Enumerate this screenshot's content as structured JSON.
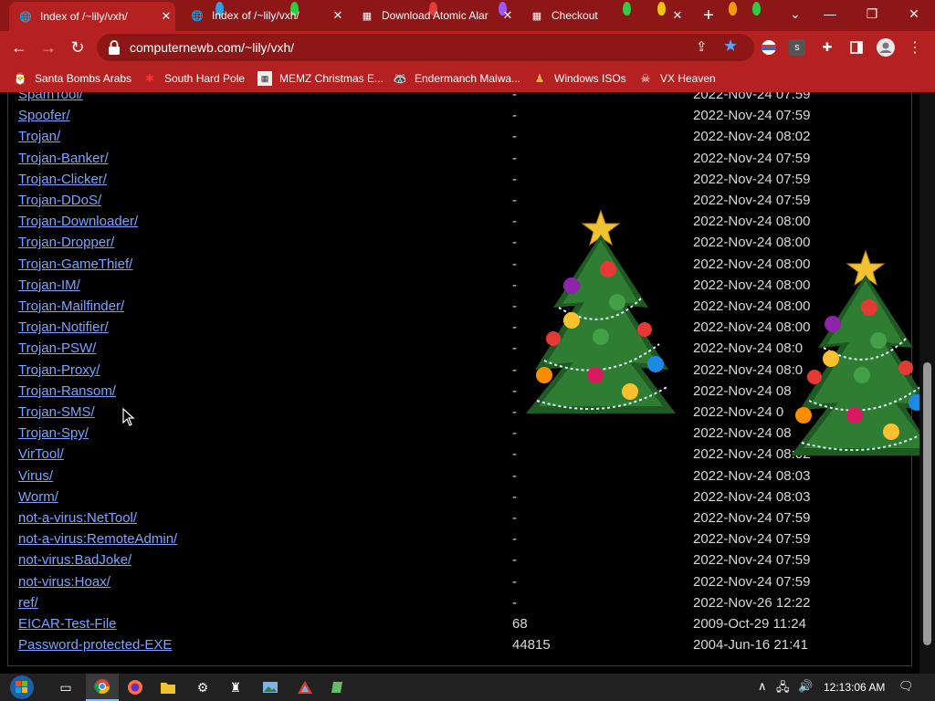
{
  "browser": {
    "tabs": [
      {
        "title": "Index of /~lily/vxh/",
        "active": true
      },
      {
        "title": "Index of /~lily/vxh/",
        "active": false
      },
      {
        "title": "Download Atomic Alar",
        "active": false
      },
      {
        "title": "Checkout",
        "active": false
      }
    ],
    "url": "computernewb.com/~lily/vxh/",
    "bookmarks": [
      {
        "label": "Santa Bombs Arabs",
        "icon": "santa-icon"
      },
      {
        "label": "South Hard Pole",
        "icon": "snowflake-icon"
      },
      {
        "label": "MEMZ Christmas E...",
        "icon": "memz-icon"
      },
      {
        "label": "Endermanch Malwa...",
        "icon": "raccoon-icon"
      },
      {
        "label": "Windows ISOs",
        "icon": "figure-icon"
      },
      {
        "label": "VX Heaven",
        "icon": "skull-icon"
      }
    ],
    "accent_color": "#b52121",
    "tabstrip_color": "#8d1616"
  },
  "listing": {
    "rows": [
      {
        "name": "SpamTool/",
        "size": "-",
        "date": "2022-Nov-24 07:59"
      },
      {
        "name": "Spoofer/",
        "size": "-",
        "date": "2022-Nov-24 07:59"
      },
      {
        "name": "Trojan/",
        "size": "-",
        "date": "2022-Nov-24 08:02"
      },
      {
        "name": "Trojan-Banker/",
        "size": "-",
        "date": "2022-Nov-24 07:59"
      },
      {
        "name": "Trojan-Clicker/",
        "size": "-",
        "date": "2022-Nov-24 07:59"
      },
      {
        "name": "Trojan-DDoS/",
        "size": "-",
        "date": "2022-Nov-24 07:59"
      },
      {
        "name": "Trojan-Downloader/",
        "size": "-",
        "date": "2022-Nov-24 08:00"
      },
      {
        "name": "Trojan-Dropper/",
        "size": "-",
        "date": "2022-Nov-24 08:00"
      },
      {
        "name": "Trojan-GameThief/",
        "size": "-",
        "date": "2022-Nov-24 08:00"
      },
      {
        "name": "Trojan-IM/",
        "size": "-",
        "date": "2022-Nov-24 08:00"
      },
      {
        "name": "Trojan-Mailfinder/",
        "size": "-",
        "date": "2022-Nov-24 08:00"
      },
      {
        "name": "Trojan-Notifier/",
        "size": "-",
        "date": "2022-Nov-24 08:00"
      },
      {
        "name": "Trojan-PSW/",
        "size": "-",
        "date": "2022-Nov-24 08:0"
      },
      {
        "name": "Trojan-Proxy/",
        "size": "-",
        "date": "2022-Nov-24 08:0"
      },
      {
        "name": "Trojan-Ransom/",
        "size": "-",
        "date": "2022-Nov-24 08"
      },
      {
        "name": "Trojan-SMS/",
        "size": "-",
        "date": "2022-Nov-24 0"
      },
      {
        "name": "Trojan-Spy/",
        "size": "-",
        "date": "2022-Nov-24 08"
      },
      {
        "name": "VirTool/",
        "size": "-",
        "date": "2022-Nov-24 08:02"
      },
      {
        "name": "Virus/",
        "size": "-",
        "date": "2022-Nov-24 08:03"
      },
      {
        "name": "Worm/",
        "size": "-",
        "date": "2022-Nov-24 08:03"
      },
      {
        "name": "not-a-virus:NetTool/",
        "size": "-",
        "date": "2022-Nov-24 07:59"
      },
      {
        "name": "not-a-virus:RemoteAdmin/",
        "size": "-",
        "date": "2022-Nov-24 07:59"
      },
      {
        "name": "not-virus:BadJoke/",
        "size": "-",
        "date": "2022-Nov-24 07:59"
      },
      {
        "name": "not-virus:Hoax/",
        "size": "-",
        "date": "2022-Nov-24 07:59"
      },
      {
        "name": "ref/",
        "size": "-",
        "date": "2022-Nov-26 12:22"
      },
      {
        "name": "EICAR-Test-File",
        "size": "68",
        "date": "2009-Oct-29 11:24"
      },
      {
        "name": "Password-protected-EXE",
        "size": "44815",
        "date": "2004-Jun-16 21:41"
      }
    ],
    "link_color": "#7aa4ff"
  },
  "taskbar": {
    "clock": "12:13:06 AM"
  }
}
